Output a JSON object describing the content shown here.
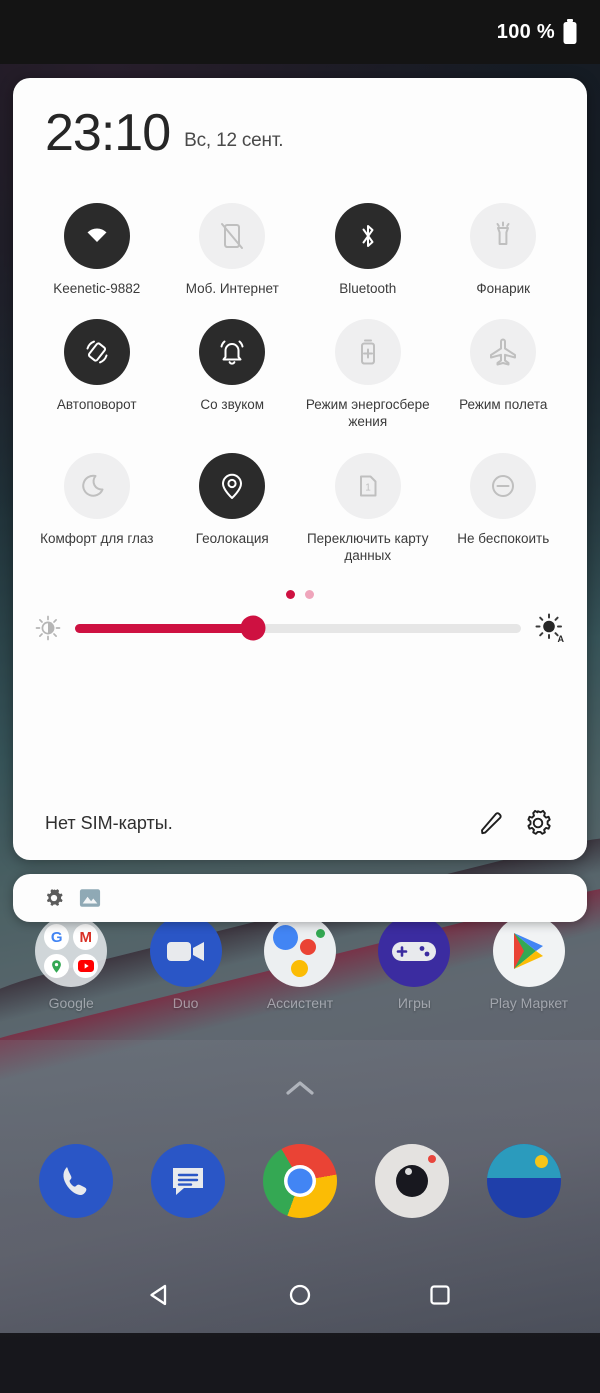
{
  "status_bar": {
    "battery_percent": "100 %",
    "battery_icon": "battery-full-icon"
  },
  "quick_settings": {
    "clock": "23:10",
    "date": "Вс, 12 сент.",
    "accent_color": "#CE1141",
    "active_tile_bg": "#2B2B2B",
    "inactive_tile_bg": "#EFEFF0",
    "tiles": [
      {
        "label": "Keenetic-9882",
        "icon": "wifi-icon",
        "state": "on"
      },
      {
        "label": "Моб. Интернет",
        "icon": "mobile-data-off-icon",
        "state": "off"
      },
      {
        "label": "Bluetooth",
        "icon": "bluetooth-icon",
        "state": "on"
      },
      {
        "label": "Фонарик",
        "icon": "flashlight-icon",
        "state": "off"
      },
      {
        "label": "Автоповорот",
        "icon": "auto-rotate-icon",
        "state": "on"
      },
      {
        "label": "Со звуком",
        "icon": "bell-ring-icon",
        "state": "on"
      },
      {
        "label": "Режим энергосбережения",
        "icon": "battery-saver-icon",
        "state": "off"
      },
      {
        "label": "Режим полета",
        "icon": "airplane-icon",
        "state": "off"
      },
      {
        "label": "Комфорт для глаз",
        "icon": "moon-icon",
        "state": "off"
      },
      {
        "label": "Геолокация",
        "icon": "location-pin-icon",
        "state": "on"
      },
      {
        "label": "Переключить карту данных",
        "icon": "sim-card-1-icon",
        "state": "off"
      },
      {
        "label": "Не беспокоить",
        "icon": "do-not-disturb-icon",
        "state": "off"
      }
    ],
    "page_dots": {
      "count": 2,
      "active_index": 0
    },
    "brightness": {
      "value_percent": 40,
      "low_icon": "brightness-low-icon",
      "auto_icon": "brightness-auto-icon"
    },
    "footer": {
      "sim_status": "Нет SIM-карты.",
      "edit_icon": "pencil-edit-icon",
      "settings_icon": "gear-icon"
    }
  },
  "notification_strip": {
    "icons": [
      "gear-icon",
      "image-icon"
    ]
  },
  "home_screen": {
    "apps": [
      {
        "label": "Google",
        "icon": "google-folder-icon"
      },
      {
        "label": "Duo",
        "icon": "duo-icon"
      },
      {
        "label": "Ассистент",
        "icon": "assistant-icon"
      },
      {
        "label": "Игры",
        "icon": "games-icon"
      },
      {
        "label": "Play Маркет",
        "icon": "play-store-icon"
      }
    ],
    "drawer_chevron": "chevron-up-icon",
    "dock": [
      {
        "icon": "phone-icon"
      },
      {
        "icon": "messages-icon"
      },
      {
        "icon": "chrome-icon"
      },
      {
        "icon": "camera-icon"
      },
      {
        "icon": "gallery-icon"
      }
    ]
  },
  "nav_bar": {
    "back": "back-triangle-icon",
    "home": "home-circle-icon",
    "recents": "recents-square-icon"
  }
}
